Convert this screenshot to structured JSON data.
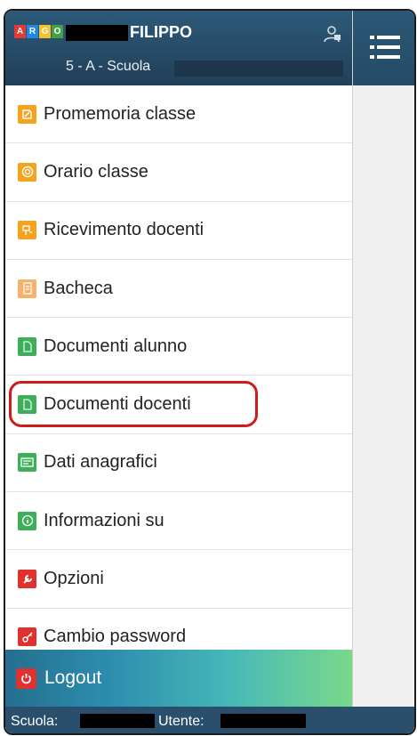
{
  "header": {
    "logo_letters": [
      "A",
      "R",
      "G",
      "O"
    ],
    "logo_colors": [
      "#e53935",
      "#1e88e5",
      "#fbc02d",
      "#43a047"
    ],
    "student_name": "FILIPPO",
    "class_text": "5 - A - Scuola",
    "profile_icon": "user-lock-icon"
  },
  "toggle": {
    "icon": "hamburger-menu-icon"
  },
  "menu": {
    "items": [
      {
        "label": "Promemoria classe",
        "icon": "note-icon",
        "color": "#f5a21c"
      },
      {
        "label": "Orario classe",
        "icon": "clock-icon",
        "color": "#f5a21c"
      },
      {
        "label": "Ricevimento docenti",
        "icon": "meeting-icon",
        "color": "#f5a21c"
      },
      {
        "label": "Bacheca",
        "icon": "board-icon",
        "color": "#f5a21c"
      },
      {
        "label": "Documenti alunno",
        "icon": "document-icon",
        "color": "#3fae5b"
      },
      {
        "label": "Documenti docenti",
        "icon": "document-icon",
        "color": "#3fae5b"
      },
      {
        "label": "Dati anagrafici",
        "icon": "id-card-icon",
        "color": "#3fae5b"
      },
      {
        "label": "Informazioni su",
        "icon": "info-icon",
        "color": "#3fae5b"
      },
      {
        "label": "Opzioni",
        "icon": "wrench-icon",
        "color": "#e0312f"
      },
      {
        "label": "Cambio password",
        "icon": "key-icon",
        "color": "#e0312f"
      }
    ]
  },
  "logout": {
    "label": "Logout",
    "icon": "power-icon"
  },
  "footer": {
    "school_label": "Scuola:",
    "user_label": "Utente:"
  }
}
